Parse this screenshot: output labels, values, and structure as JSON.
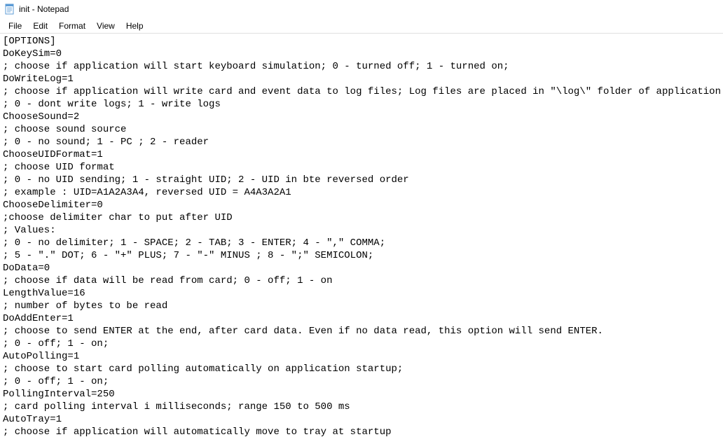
{
  "window": {
    "title": "init - Notepad"
  },
  "menu": {
    "file": "File",
    "edit": "Edit",
    "format": "Format",
    "view": "View",
    "help": "Help"
  },
  "content": "[OPTIONS]\nDoKeySim=0\n; choose if application will start keyboard simulation; 0 - turned off; 1 - turned on;\nDoWriteLog=1\n; choose if application will write card and event data to log files; Log files are placed in \"\\log\\\" folder of application root\n; 0 - dont write logs; 1 - write logs\nChooseSound=2\n; choose sound source\n; 0 - no sound; 1 - PC ; 2 - reader\nChooseUIDFormat=1\n; choose UID format\n; 0 - no UID sending; 1 - straight UID; 2 - UID in bte reversed order\n; example : UID=A1A2A3A4, reversed UID = A4A3A2A1\nChooseDelimiter=0\n;choose delimiter char to put after UID\n; Values:\n; 0 - no delimiter; 1 - SPACE; 2 - TAB; 3 - ENTER; 4 - \",\" COMMA;\n; 5 - \".\" DOT; 6 - \"+\" PLUS; 7 - \"-\" MINUS ; 8 - \";\" SEMICOLON;\nDoData=0\n; choose if data will be read from card; 0 - off; 1 - on\nLengthValue=16\n; number of bytes to be read\nDoAddEnter=1\n; choose to send ENTER at the end, after card data. Even if no data read, this option will send ENTER.\n; 0 - off; 1 - on;\nAutoPolling=1\n; choose to start card polling automatically on application startup;\n; 0 - off; 1 - on;\nPollingInterval=250\n; card polling interval i milliseconds; range 150 to 500 ms\nAutoTray=1\n; choose if application will automatically move to tray at startup"
}
